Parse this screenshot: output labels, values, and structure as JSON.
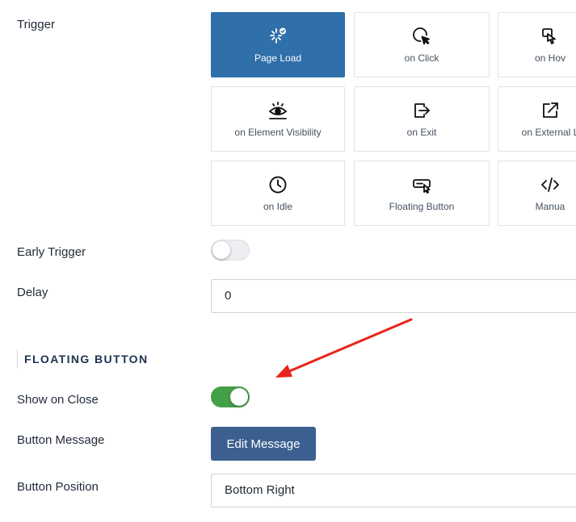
{
  "trigger": {
    "label": "Trigger",
    "options": [
      {
        "label": "Page Load",
        "icon": "page-load-icon",
        "selected": true
      },
      {
        "label": "on Click",
        "icon": "cursor-click-icon",
        "selected": false
      },
      {
        "label": "on Hov",
        "icon": "hover-hand-icon",
        "selected": false
      },
      {
        "label": "on Element Visibility",
        "icon": "eye-icon",
        "selected": false
      },
      {
        "label": "on Exit",
        "icon": "exit-icon",
        "selected": false
      },
      {
        "label": "on External L",
        "icon": "external-link-icon",
        "selected": false
      },
      {
        "label": "on Idle",
        "icon": "clock-icon",
        "selected": false
      },
      {
        "label": "Floating Button",
        "icon": "floating-button-icon",
        "selected": false
      },
      {
        "label": "Manua",
        "icon": "code-icon",
        "selected": false
      }
    ]
  },
  "early_trigger": {
    "label": "Early Trigger",
    "enabled": false
  },
  "delay": {
    "label": "Delay",
    "value": "0"
  },
  "floating_button": {
    "section_title": "FLOATING BUTTON",
    "show_on_close": {
      "label": "Show on Close",
      "enabled": true
    },
    "button_message": {
      "label": "Button Message",
      "button_label": "Edit Message"
    },
    "button_position": {
      "label": "Button Position",
      "value": "Bottom Right"
    }
  },
  "colors": {
    "selected_tile": "#2f6faa",
    "toggle_on": "#43a047",
    "button": "#3b5f8f",
    "annotation_arrow": "#e8231b"
  }
}
